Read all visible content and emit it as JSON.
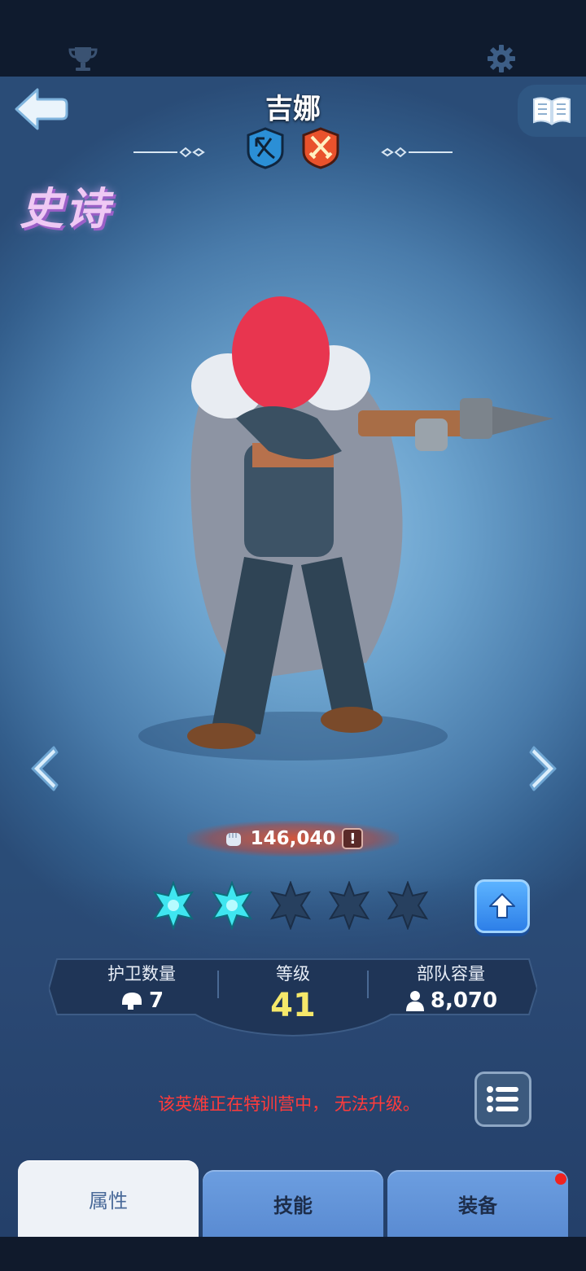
{
  "header": {
    "hero_name": "吉娜",
    "rarity": "史诗",
    "class_icons": [
      "crossbow-icon",
      "crossed-swords-icon"
    ]
  },
  "top_bar": {
    "icons": [
      "trophy-icon",
      "gear-icon"
    ]
  },
  "power": {
    "value": "146,040",
    "alert": "!"
  },
  "stars": {
    "total": 5,
    "filled": 2
  },
  "stats": {
    "guard_label": "护卫数量",
    "guard_value": "7",
    "level_label": "等级",
    "level_value": "41",
    "troop_label": "部队容量",
    "troop_value": "8,070"
  },
  "warning": "该英雄正在特训营中， 无法升级。",
  "tabs": [
    {
      "label": "属性",
      "active": true
    },
    {
      "label": "技能",
      "active": false
    },
    {
      "label": "装备",
      "active": false,
      "badge": true
    }
  ],
  "colors": {
    "rarity": "#efc9f4",
    "level": "#f5e86a",
    "warning": "#ff3b3b",
    "star_filled": "#3fe6f0"
  }
}
